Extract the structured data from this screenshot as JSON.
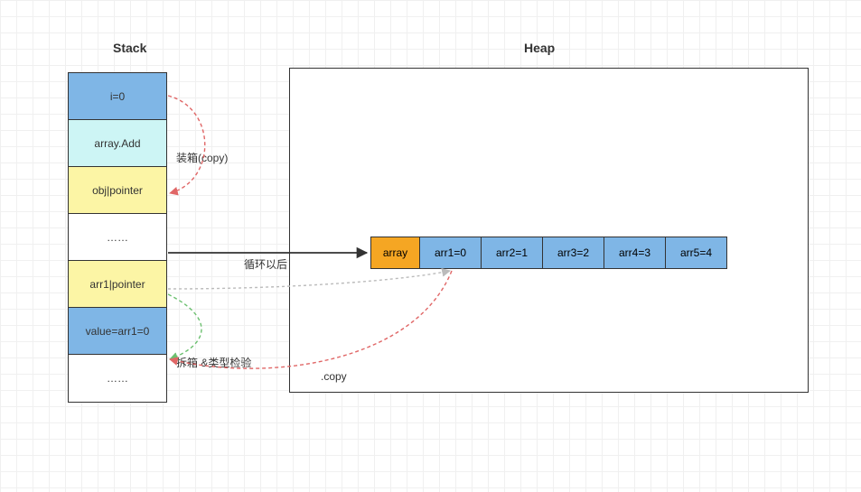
{
  "titles": {
    "stack": "Stack",
    "heap": "Heap"
  },
  "stack": {
    "cells": [
      {
        "label": "i=0",
        "color": "blue"
      },
      {
        "label": "array.Add",
        "color": "cyan"
      },
      {
        "label": "obj|pointer",
        "color": "yellow"
      },
      {
        "label": "……",
        "color": "white"
      },
      {
        "label": "arr1|pointer",
        "color": "yellow"
      },
      {
        "label": "value=arr1=0",
        "color": "blue"
      },
      {
        "label": "……",
        "color": "white"
      }
    ]
  },
  "heap": {
    "array_head": "array",
    "cells": [
      {
        "label": "arr1=0"
      },
      {
        "label": "arr2=1"
      },
      {
        "label": "arr3=2"
      },
      {
        "label": "arr4=3"
      },
      {
        "label": "arr5=4"
      }
    ]
  },
  "labels": {
    "boxing": "装箱(copy)",
    "loop": "循环以后",
    "unboxing": "拆箱 &类型检验",
    "copy": ".copy"
  },
  "chart_data": {
    "type": "diagram",
    "description": "C# boxing/unboxing memory model showing Stack frames and Heap array",
    "stack_frames": [
      "i=0",
      "array.Add",
      "obj|pointer",
      "……",
      "arr1|pointer",
      "value=arr1=0",
      "……"
    ],
    "heap_array": {
      "name": "array",
      "elements": [
        "arr1=0",
        "arr2=1",
        "arr3=2",
        "arr4=3",
        "arr5=4"
      ]
    },
    "arrows": [
      {
        "from": "i=0",
        "to": "obj|pointer",
        "style": "dotted-red",
        "label": "装箱(copy)"
      },
      {
        "from": "……(stack mid)",
        "to": "heap array",
        "style": "solid-black",
        "label": "循环以后"
      },
      {
        "from": "arr1|pointer",
        "to": "heap arr1",
        "style": "dotted-gray"
      },
      {
        "from": "heap arr1",
        "to": "value=arr1=0",
        "style": "dotted-red",
        "label": ".copy"
      },
      {
        "from": "arr1|pointer",
        "to": "value=arr1=0",
        "style": "dotted-green",
        "label": "拆箱 &类型检验"
      }
    ]
  }
}
